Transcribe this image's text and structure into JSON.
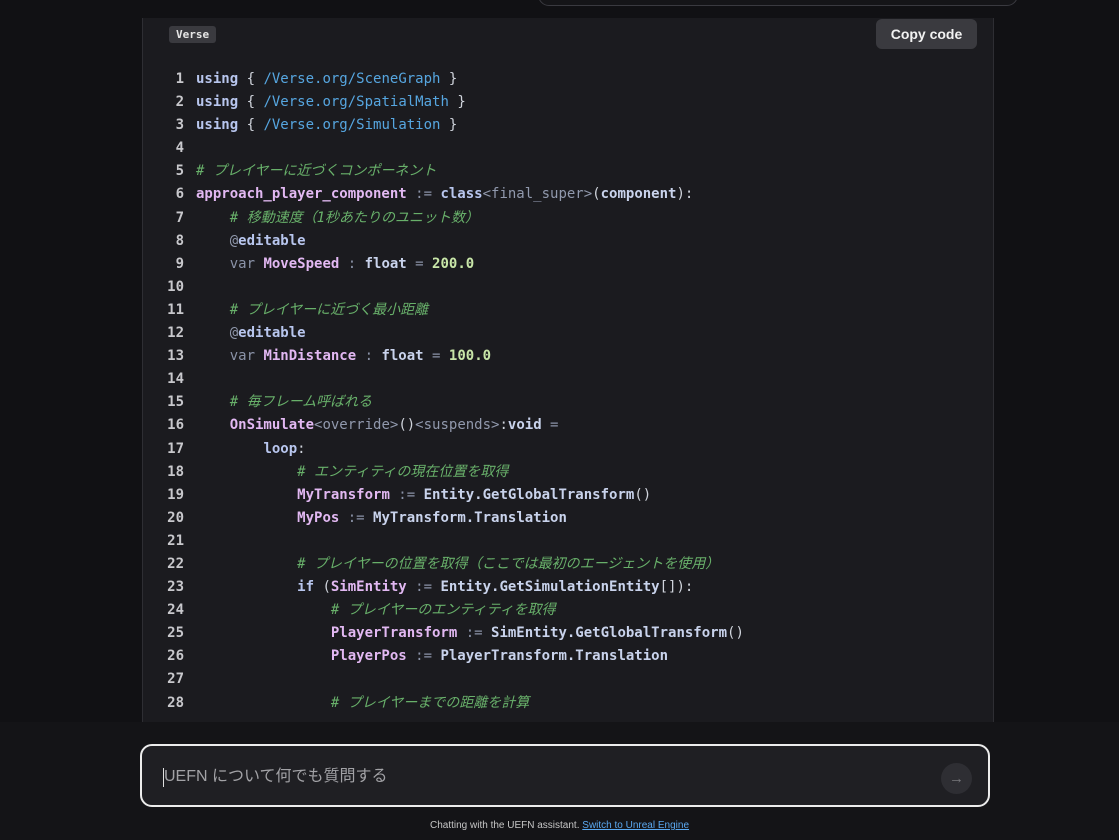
{
  "code_block": {
    "language": "Verse",
    "copy_label": "Copy code",
    "lines": [
      {
        "n": "1",
        "indent": "",
        "tokens": [
          [
            "kw",
            "using"
          ],
          [
            "punc",
            " { "
          ],
          [
            "path",
            "/Verse.org/SceneGraph"
          ],
          [
            "punc",
            " }"
          ]
        ]
      },
      {
        "n": "2",
        "indent": "",
        "tokens": [
          [
            "kw",
            "using"
          ],
          [
            "punc",
            " { "
          ],
          [
            "path",
            "/Verse.org/SpatialMath"
          ],
          [
            "punc",
            " }"
          ]
        ]
      },
      {
        "n": "3",
        "indent": "",
        "tokens": [
          [
            "kw",
            "using"
          ],
          [
            "punc",
            " { "
          ],
          [
            "path",
            "/Verse.org/Simulation"
          ],
          [
            "punc",
            " }"
          ]
        ]
      },
      {
        "n": "4",
        "indent": "",
        "tokens": []
      },
      {
        "n": "5",
        "indent": "",
        "tokens": [
          [
            "com",
            "# プレイヤーに近づくコンポーネント"
          ]
        ]
      },
      {
        "n": "6",
        "indent": "",
        "tokens": [
          [
            "id",
            "approach_player_component"
          ],
          [
            "op",
            " := "
          ],
          [
            "kw",
            "class"
          ],
          [
            "spec",
            "<final_super>"
          ],
          [
            "punc",
            "("
          ],
          [
            "ty",
            "component"
          ],
          [
            "punc",
            "):"
          ]
        ]
      },
      {
        "n": "7",
        "indent": "    ",
        "tokens": [
          [
            "com",
            "# 移動速度（1秒あたりのユニット数）"
          ]
        ]
      },
      {
        "n": "8",
        "indent": "    ",
        "tokens": [
          [
            "spec",
            "@"
          ],
          [
            "kw",
            "editable"
          ]
        ]
      },
      {
        "n": "9",
        "indent": "    ",
        "tokens": [
          [
            "kw2",
            "var "
          ],
          [
            "id",
            "MoveSpeed"
          ],
          [
            "op",
            " : "
          ],
          [
            "ty",
            "float"
          ],
          [
            "op",
            " = "
          ],
          [
            "num",
            "200.0"
          ]
        ]
      },
      {
        "n": "10",
        "indent": "",
        "tokens": []
      },
      {
        "n": "11",
        "indent": "    ",
        "tokens": [
          [
            "com",
            "# プレイヤーに近づく最小距離"
          ]
        ]
      },
      {
        "n": "12",
        "indent": "    ",
        "tokens": [
          [
            "spec",
            "@"
          ],
          [
            "kw",
            "editable"
          ]
        ]
      },
      {
        "n": "13",
        "indent": "    ",
        "tokens": [
          [
            "kw2",
            "var "
          ],
          [
            "id",
            "MinDistance"
          ],
          [
            "op",
            " : "
          ],
          [
            "ty",
            "float"
          ],
          [
            "op",
            " = "
          ],
          [
            "num",
            "100.0"
          ]
        ]
      },
      {
        "n": "14",
        "indent": "",
        "tokens": []
      },
      {
        "n": "15",
        "indent": "    ",
        "tokens": [
          [
            "com",
            "# 毎フレーム呼ばれる"
          ]
        ]
      },
      {
        "n": "16",
        "indent": "    ",
        "tokens": [
          [
            "id",
            "OnSimulate"
          ],
          [
            "spec",
            "<override>"
          ],
          [
            "punc",
            "()"
          ],
          [
            "spec",
            "<suspends>"
          ],
          [
            "punc",
            ":"
          ],
          [
            "ty",
            "void"
          ],
          [
            "op",
            " ="
          ]
        ]
      },
      {
        "n": "17",
        "indent": "        ",
        "tokens": [
          [
            "kw",
            "loop"
          ],
          [
            "punc",
            ":"
          ]
        ]
      },
      {
        "n": "18",
        "indent": "            ",
        "tokens": [
          [
            "com",
            "# エンティティの現在位置を取得"
          ]
        ]
      },
      {
        "n": "19",
        "indent": "            ",
        "tokens": [
          [
            "id",
            "MyTransform"
          ],
          [
            "op",
            " := "
          ],
          [
            "ty",
            "Entity.GetGlobalTransform"
          ],
          [
            "punc",
            "()"
          ]
        ]
      },
      {
        "n": "20",
        "indent": "            ",
        "tokens": [
          [
            "id",
            "MyPos"
          ],
          [
            "op",
            " := "
          ],
          [
            "ty",
            "MyTransform.Translation"
          ]
        ]
      },
      {
        "n": "21",
        "indent": "",
        "tokens": []
      },
      {
        "n": "22",
        "indent": "            ",
        "tokens": [
          [
            "com",
            "# プレイヤーの位置を取得（ここでは最初のエージェントを使用）"
          ]
        ]
      },
      {
        "n": "23",
        "indent": "            ",
        "tokens": [
          [
            "kw",
            "if"
          ],
          [
            "punc",
            " ("
          ],
          [
            "id",
            "SimEntity"
          ],
          [
            "op",
            " := "
          ],
          [
            "ty",
            "Entity.GetSimulationEntity"
          ],
          [
            "punc",
            "[]):"
          ]
        ]
      },
      {
        "n": "24",
        "indent": "                ",
        "tokens": [
          [
            "com",
            "# プレイヤーのエンティティを取得"
          ]
        ]
      },
      {
        "n": "25",
        "indent": "                ",
        "tokens": [
          [
            "id",
            "PlayerTransform"
          ],
          [
            "op",
            " := "
          ],
          [
            "ty",
            "SimEntity.GetGlobalTransform"
          ],
          [
            "punc",
            "()"
          ]
        ]
      },
      {
        "n": "26",
        "indent": "                ",
        "tokens": [
          [
            "id",
            "PlayerPos"
          ],
          [
            "op",
            " := "
          ],
          [
            "ty",
            "PlayerTransform.Translation"
          ]
        ]
      },
      {
        "n": "27",
        "indent": "",
        "tokens": []
      },
      {
        "n": "28",
        "indent": "                ",
        "tokens": [
          [
            "com",
            "# プレイヤーまでの距離を計算"
          ]
        ]
      }
    ]
  },
  "chat_input": {
    "placeholder": "UEFN について何でも質問する",
    "send_icon": "→"
  },
  "footer": {
    "text": "Chatting with the UEFN assistant.",
    "link": "Switch to Unreal Engine"
  }
}
